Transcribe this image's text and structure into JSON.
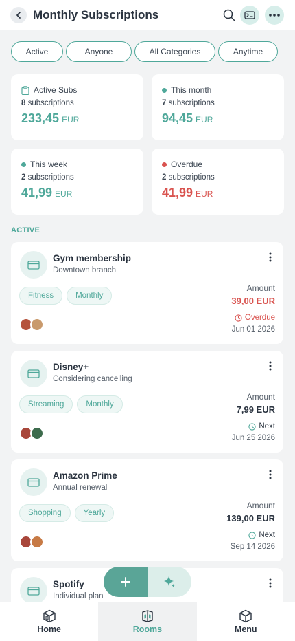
{
  "header": {
    "title": "Monthly Subscriptions"
  },
  "filters": [
    {
      "label": "Active"
    },
    {
      "label": "Anyone"
    },
    {
      "label": "All Categories"
    },
    {
      "label": "Anytime"
    }
  ],
  "stats": {
    "active": {
      "label": "Active Subs",
      "count": "8",
      "count_suffix": "subscriptions",
      "amount": "233,45",
      "currency": "EUR"
    },
    "month": {
      "label": "This month",
      "count": "7",
      "count_suffix": "subscriptions",
      "amount": "94,45",
      "currency": "EUR",
      "dot_color": "#4fa89a"
    },
    "week": {
      "label": "This week",
      "count": "2",
      "count_suffix": "subscriptions",
      "amount": "41,99",
      "currency": "EUR",
      "dot_color": "#4fa89a"
    },
    "overdue": {
      "label": "Overdue",
      "count": "2",
      "count_suffix": "subscriptions",
      "amount": "41,99",
      "currency": "EUR",
      "dot_color": "#d9534f"
    }
  },
  "section": {
    "label": "ACTIVE"
  },
  "subscriptions": [
    {
      "name": "Gym membership",
      "subtitle": "Downtown branch",
      "tags": [
        "Fitness",
        "Monthly"
      ],
      "amount_label": "Amount",
      "amount": "39,00 EUR",
      "status": "Overdue",
      "date": "Jun 01 2026"
    },
    {
      "name": "Disney+",
      "subtitle": "Considering cancelling",
      "tags": [
        "Streaming",
        "Monthly"
      ],
      "amount_label": "Amount",
      "amount": "7,99 EUR",
      "status": "Next",
      "date": "Jun 25 2026"
    },
    {
      "name": "Amazon Prime",
      "subtitle": "Annual renewal",
      "tags": [
        "Shopping",
        "Yearly"
      ],
      "amount_label": "Amount",
      "amount": "139,00 EUR",
      "status": "Next",
      "date": "Sep 14 2026"
    },
    {
      "name": "Spotify",
      "subtitle": "Individual plan"
    }
  ],
  "nav": [
    {
      "label": "Home"
    },
    {
      "label": "Rooms"
    },
    {
      "label": "Menu"
    }
  ],
  "colors": {
    "accent": "#4fa89a",
    "overdue": "#d9534f",
    "text": "#2b3440"
  }
}
